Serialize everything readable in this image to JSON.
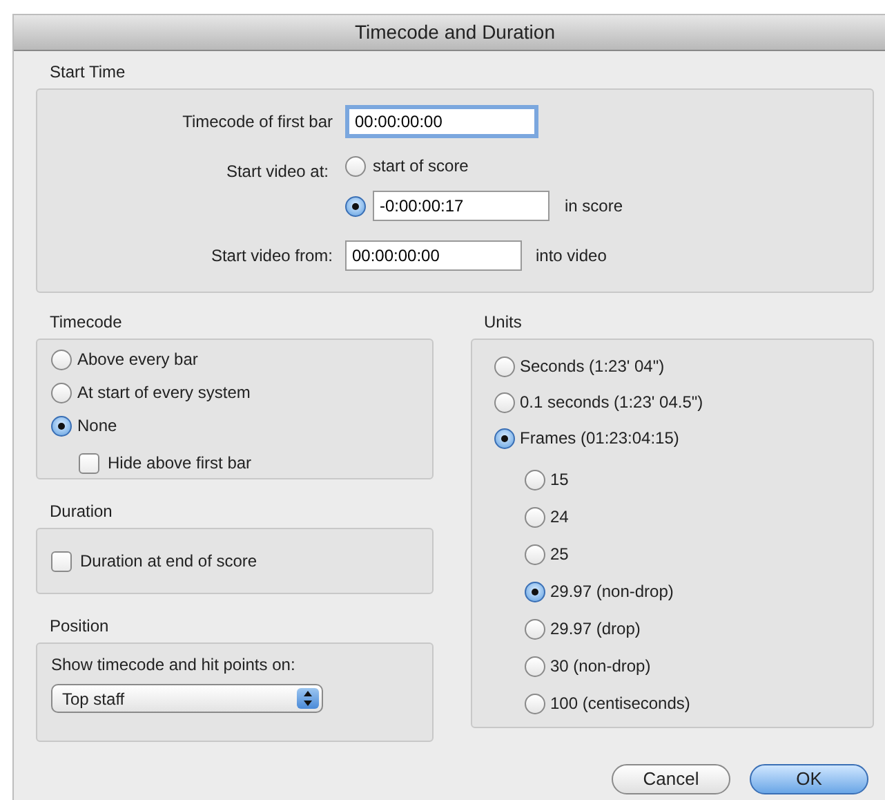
{
  "window": {
    "title": "Timecode and Duration"
  },
  "start_time": {
    "label": "Start Time",
    "timecode_first_bar": {
      "label": "Timecode of first bar",
      "value": "00:00:00:00",
      "focused": true
    },
    "start_video_at": {
      "label": "Start video at:",
      "options": [
        {
          "kind": "plain",
          "label": "start of score",
          "selected": false
        },
        {
          "kind": "field",
          "value": "-0:00:00:17",
          "suffix": "in score",
          "selected": true
        }
      ]
    },
    "start_video_from": {
      "label": "Start video from:",
      "value": "00:00:00:00",
      "suffix": "into video"
    }
  },
  "timecode": {
    "label": "Timecode",
    "options": [
      {
        "label": "Above every bar",
        "selected": false
      },
      {
        "label": "At start of every system",
        "selected": false
      },
      {
        "label": "None",
        "selected": true
      }
    ],
    "hide_above_first_bar": {
      "label": "Hide above first bar",
      "checked": false
    }
  },
  "duration": {
    "label": "Duration",
    "at_end": {
      "label": "Duration at end of score",
      "checked": false
    }
  },
  "position": {
    "label": "Position",
    "prompt": "Show timecode and hit points on:",
    "select": {
      "value": "Top staff"
    }
  },
  "units": {
    "label": "Units",
    "options": [
      {
        "label": "Seconds (1:23' 04\")",
        "selected": false
      },
      {
        "label": "0.1 seconds (1:23' 04.5\")",
        "selected": false
      },
      {
        "label": "Frames (01:23:04:15)",
        "selected": true,
        "children": [
          {
            "label": "15",
            "selected": false
          },
          {
            "label": "24",
            "selected": false
          },
          {
            "label": "25",
            "selected": false
          },
          {
            "label": "29.97 (non-drop)",
            "selected": true
          },
          {
            "label": "29.97 (drop)",
            "selected": false
          },
          {
            "label": "30 (non-drop)",
            "selected": false
          },
          {
            "label": "100 (centiseconds)",
            "selected": false
          }
        ]
      }
    ]
  },
  "buttons": [
    {
      "label": "Cancel",
      "default": false
    },
    {
      "label": "OK",
      "default": true
    }
  ]
}
